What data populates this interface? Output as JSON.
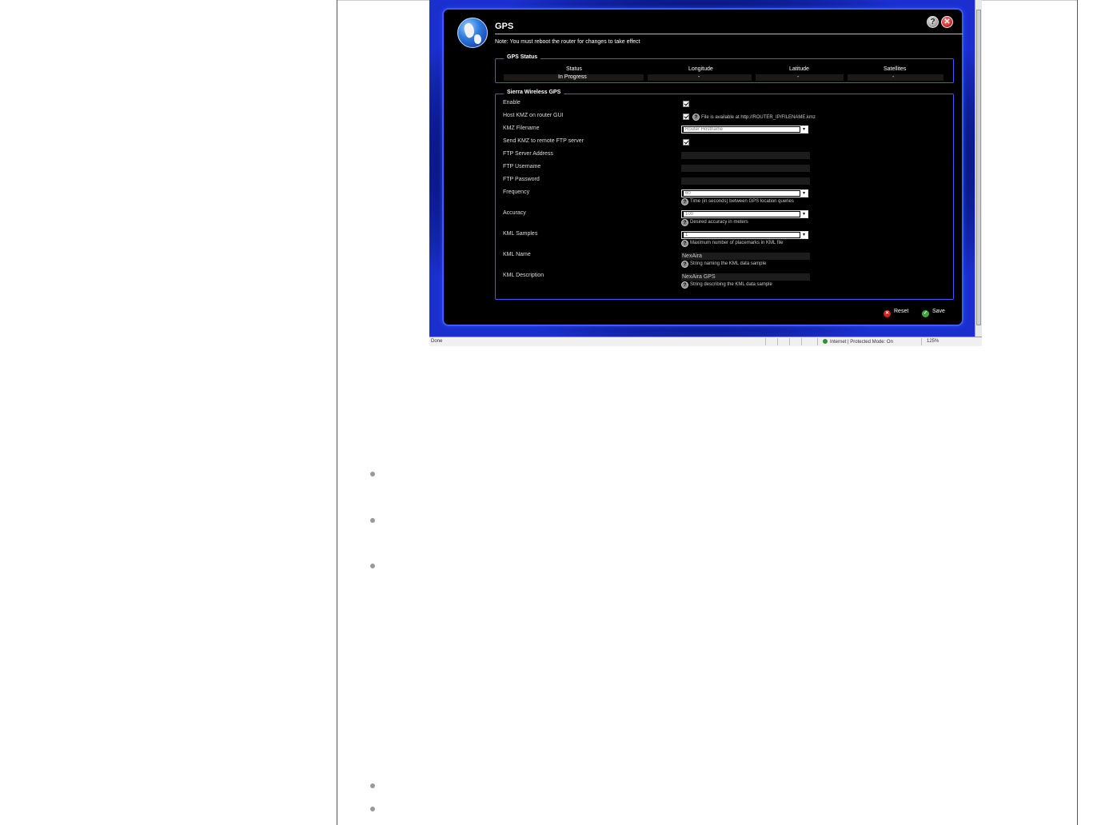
{
  "dialog": {
    "title": "GPS",
    "note": "Note: You must reboot the router for changes to take effect",
    "help_glyph": "?",
    "close_glyph": "✕"
  },
  "gps_status": {
    "legend": "GPS Status",
    "columns": [
      "Status",
      "Longitude",
      "Latitude",
      "Satellites"
    ],
    "values": [
      "In Progress",
      "-",
      "-",
      "-"
    ]
  },
  "sierra": {
    "legend": "Sierra Wireless GPS",
    "labels": {
      "enable": "Enable",
      "host_kmz": "Host KMZ on router GUI",
      "kmz_filename": "KMZ Filename",
      "send_kmz": "Send KMZ to remote FTP server",
      "ftp_server": "FTP Server Address",
      "ftp_username": "FTP Username",
      "ftp_password": "FTP Password",
      "frequency": "Frequency",
      "accuracy": "Accuracy",
      "kml_samples": "KML Samples",
      "kml_name": "KML Name",
      "kml_description": "KML Description"
    },
    "host_kmz_hint": "File is available at http://ROUTER_IP/FILENAME.kmz",
    "kmz_filename_value": "Router Hostname",
    "frequency_value": "60",
    "frequency_hint": "Time (in seconds) between GPS location queries",
    "accuracy_value": "100",
    "accuracy_hint": "Desired accuracy in meters",
    "kml_samples_value": "1",
    "kml_samples_hint": "Maximum number of placemarks in KML file",
    "kml_name_value": "NexAira",
    "kml_name_hint": "String naming the KML data sample",
    "kml_description_value": "NexAira GPS",
    "kml_description_hint": "String describing the KML data sample"
  },
  "actions": {
    "reset": "Reset",
    "save": "Save",
    "reset_glyph": "✕",
    "save_glyph": "✓"
  },
  "browser_status": {
    "done": "Done",
    "zone": "Internet | Protected Mode: On",
    "zoom": "125%"
  },
  "icons": {
    "globe": "globe-icon",
    "help": "help-icon",
    "close": "close-icon",
    "reset": "reset-icon",
    "save": "save-icon"
  },
  "colors": {
    "dialog_border": "#3a5cff",
    "glow": "#1b2fd0",
    "close": "#d42020",
    "save": "#3ea83e"
  }
}
